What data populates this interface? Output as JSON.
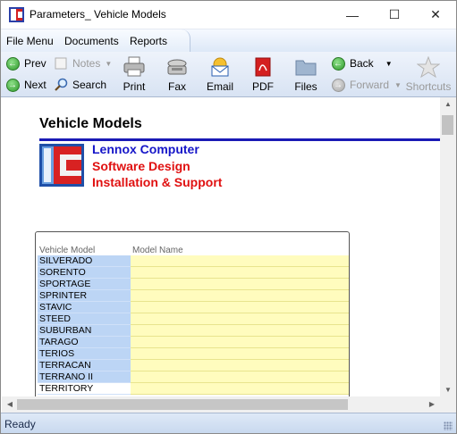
{
  "window": {
    "title": "Parameters_ Vehicle Models",
    "minimize_glyph": "—",
    "maximize_glyph": "☐",
    "close_glyph": "✕"
  },
  "menu": {
    "items": [
      "File Menu",
      "Documents",
      "Reports"
    ]
  },
  "toolbar": {
    "prev": "Prev",
    "next": "Next",
    "notes": "Notes",
    "search": "Search",
    "print": "Print",
    "fax": "Fax",
    "email": "Email",
    "pdf": "PDF",
    "files": "Files",
    "back": "Back",
    "forward": "Forward",
    "shortcuts": "Shortcuts"
  },
  "document": {
    "title": "Vehicle Models",
    "company_lines": [
      "Lennox Computer",
      "Software Design",
      "Installation & Support"
    ],
    "logo_letters": "LC"
  },
  "grid": {
    "headers": [
      "Vehicle Model",
      "Model Name"
    ],
    "rows": [
      {
        "model": "SILVERADO",
        "name": ""
      },
      {
        "model": "SORENTO",
        "name": ""
      },
      {
        "model": "SPORTAGE",
        "name": ""
      },
      {
        "model": "SPRINTER",
        "name": ""
      },
      {
        "model": "STAVIC",
        "name": ""
      },
      {
        "model": "STEED",
        "name": ""
      },
      {
        "model": "SUBURBAN",
        "name": ""
      },
      {
        "model": "TARAGO",
        "name": ""
      },
      {
        "model": "TERIOS",
        "name": ""
      },
      {
        "model": "TERRACAN",
        "name": ""
      },
      {
        "model": "TERRANO II",
        "name": ""
      },
      {
        "model": "TERRITORY",
        "name": ""
      }
    ],
    "selected_row": 11
  },
  "status": {
    "text": "Ready"
  },
  "colors": {
    "company_blue": "#1515c8",
    "company_red": "#e01010",
    "rule_blue": "#1a1ab5",
    "model_cell": "#bcd5f5",
    "name_cell": "#fffcbe"
  }
}
